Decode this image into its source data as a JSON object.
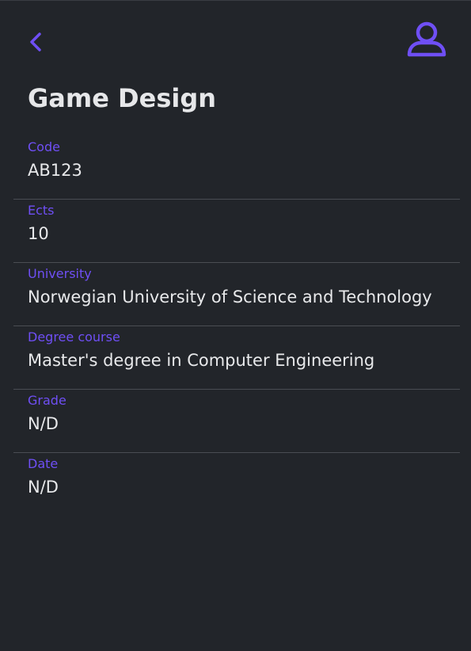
{
  "colors": {
    "background": "#22252a",
    "accent": "#6f4ff5",
    "text": "#e8e9eb",
    "divider": "#4a4d53"
  },
  "header": {
    "back_icon": "chevron-left-icon",
    "profile_icon": "user-icon"
  },
  "page": {
    "title": "Game Design"
  },
  "fields": [
    {
      "label": "Code",
      "value": "AB123"
    },
    {
      "label": "Ects",
      "value": "10"
    },
    {
      "label": "University",
      "value": "Norwegian University of Science and Technology"
    },
    {
      "label": "Degree course",
      "value": "Master's degree in Computer Engineering"
    },
    {
      "label": "Grade",
      "value": "N/D"
    },
    {
      "label": "Date",
      "value": "N/D"
    }
  ]
}
